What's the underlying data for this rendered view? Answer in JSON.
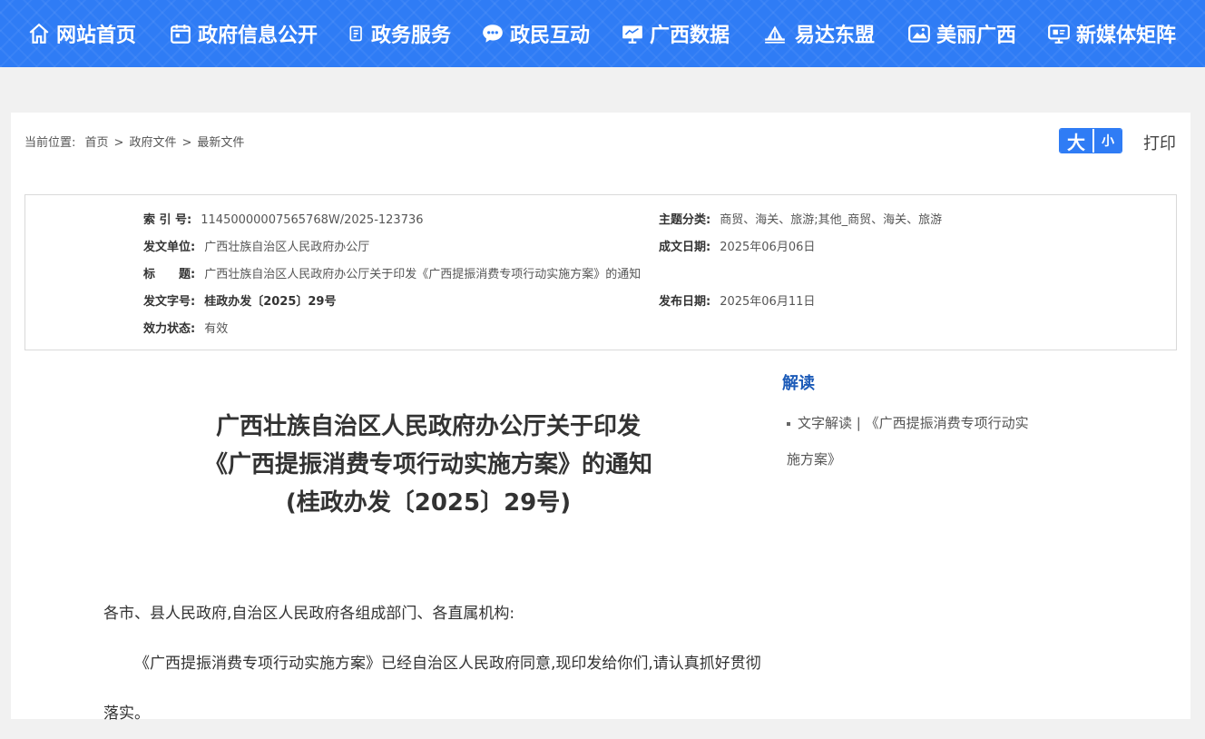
{
  "nav": {
    "items": [
      {
        "label": "网站首页",
        "icon": "home-icon"
      },
      {
        "label": "政府信息公开",
        "icon": "calendar-icon"
      },
      {
        "label": "政务服务",
        "icon": "document-icon"
      },
      {
        "label": "政民互动",
        "icon": "chat-icon"
      },
      {
        "label": "广西数据",
        "icon": "monitor-icon"
      },
      {
        "label": "易达东盟",
        "icon": "bridge-icon"
      },
      {
        "label": "美丽广西",
        "icon": "picture-icon"
      },
      {
        "label": "新媒体矩阵",
        "icon": "media-icon"
      }
    ]
  },
  "breadcrumb": {
    "prefix": "当前位置:",
    "items": [
      "首页",
      "政府文件",
      "最新文件"
    ]
  },
  "toolbar": {
    "font_big": "大",
    "font_small": "小",
    "print": "打印"
  },
  "meta": {
    "index_label": "索 引 号:",
    "index_value": "11450000007565768W/2025-123736",
    "topic_label": "主题分类:",
    "topic_value": "商贸、海关、旅游;其他_商贸、海关、旅游",
    "issuer_label": "发文单位:",
    "issuer_value": "广西壮族自治区人民政府办公厅",
    "created_label": "成文日期:",
    "created_value": "2025年06月06日",
    "title_label": "标　　题:",
    "title_value": "广西壮族自治区人民政府办公厅关于印发《广西提振消费专项行动实施方案》的通知",
    "docno_label": "发文字号:",
    "docno_value": "桂政办发〔2025〕29号",
    "published_label": "发布日期:",
    "published_value": "2025年06月11日",
    "status_label": "效力状态:",
    "status_value": "有效"
  },
  "document": {
    "title_line1": "广西壮族自治区人民政府办公厅关于印发",
    "title_line2": "《广西提振消费专项行动实施方案》的通知",
    "title_line3": "(桂政办发〔2025〕29号)",
    "salutation": "各市、县人民政府,自治区人民政府各组成部门、各直属机构:",
    "para1": "《广西提振消费专项行动实施方案》已经自治区人民政府同意,现印发给你们,请认真抓好贯彻落实。"
  },
  "sidebar": {
    "title": "解读",
    "link": "文字解读 | 《广西提振消费专项行动实施方案》"
  }
}
